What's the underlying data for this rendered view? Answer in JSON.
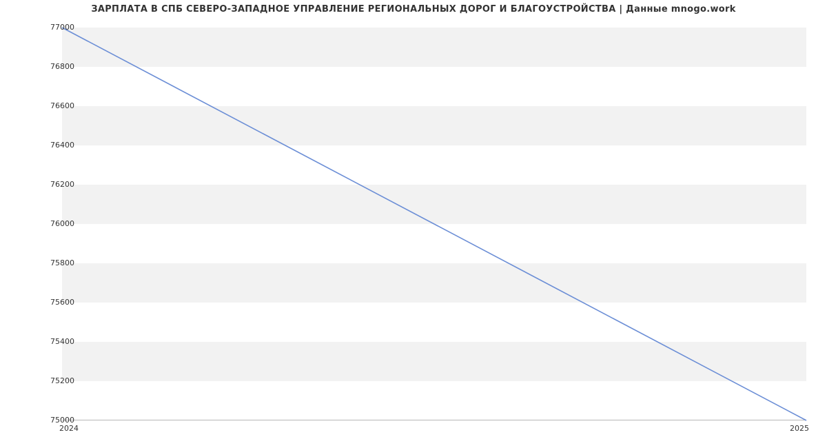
{
  "chart_data": {
    "type": "line",
    "title": "ЗАРПЛАТА В СПБ СЕВЕРО-ЗАПАДНОЕ УПРАВЛЕНИЕ РЕГИОНАЛЬНЫХ ДОРОГ И БЛАГОУСТРОЙСТВА | Данные mnogo.work",
    "x_categories": [
      "2024",
      "2025"
    ],
    "y_ticks": [
      75000,
      75200,
      75400,
      75600,
      75800,
      76000,
      76200,
      76400,
      76600,
      76800,
      77000
    ],
    "ylim": [
      75000,
      77000
    ],
    "series": [
      {
        "name": "salary",
        "color": "#6b8ed6",
        "x": [
          "2024",
          "2025"
        ],
        "y": [
          77000,
          75000
        ]
      }
    ]
  }
}
